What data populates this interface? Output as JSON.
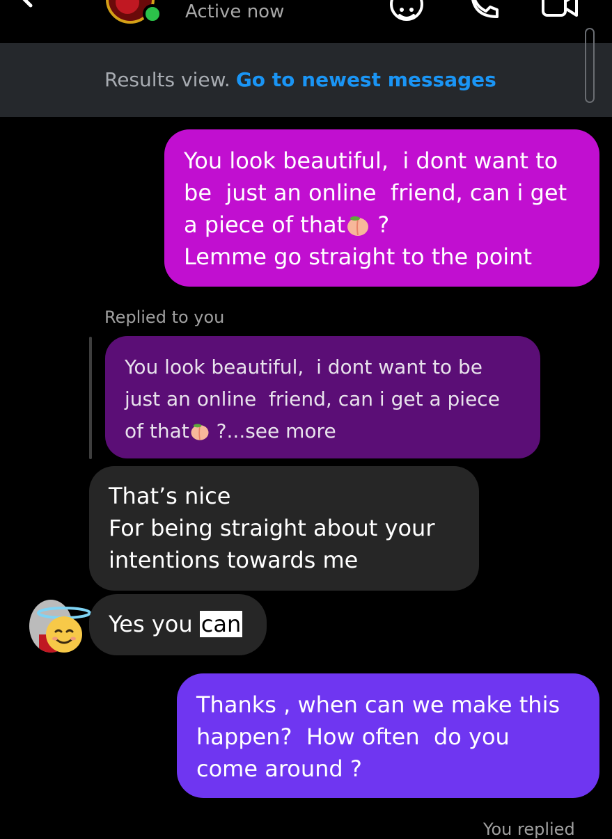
{
  "header": {
    "status": "Active now",
    "icons": [
      "back-arrow-icon",
      "sticker-icon",
      "phone-icon",
      "video-icon"
    ],
    "online_color": "#2cc14a"
  },
  "results_bar": {
    "label": "Results view.",
    "link": "Go to newest messages"
  },
  "messages": [
    {
      "from": "me",
      "text_before_emoji": "You look beautiful,  i dont want to\nbe  just an online  friend, can i get\na piece of that",
      "emoji": "peach-emoji",
      "text_after_emoji": " ?\nLemme go straight to the point",
      "color": "#c10fd0"
    },
    {
      "from": "them",
      "reply_label": "Replied to you",
      "quoted_before_emoji": "You look beautiful,  i dont want to be\njust an online  friend, can i get a piece\nof that",
      "quoted_emoji": "peach-emoji",
      "quoted_after_emoji": " ?...see more",
      "color": "#5b0e76"
    },
    {
      "from": "them",
      "text": "That’s nice\nFor being straight about your\nintentions towards me"
    },
    {
      "from": "them",
      "text_plain": "Yes you ",
      "text_highlighted": "can",
      "reaction_emoji": "smiling-face-with-halo-emoji"
    },
    {
      "from": "me",
      "text": "Thanks , when can we make this\nhappen?  How often  do you\ncome around ?",
      "color": "#6f36f1"
    }
  ],
  "footer": {
    "reply_label": "You replied"
  }
}
